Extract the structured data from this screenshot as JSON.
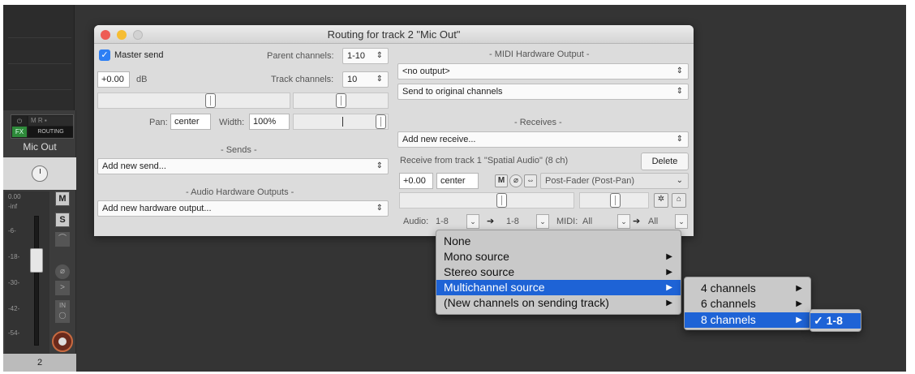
{
  "window": {
    "title": "Routing for track 2 \"Mic Out\""
  },
  "left": {
    "master_send_label": "Master send",
    "master_send_checked": true,
    "parent_channels_label": "Parent channels:",
    "parent_channels_value": "1-10",
    "volume_value": "+0.00",
    "volume_unit": "dB",
    "track_channels_label": "Track channels:",
    "track_channels_value": "10",
    "pan_label": "Pan:",
    "pan_value": "center",
    "width_label": "Width:",
    "width_value": "100%",
    "sends_header": "- Sends -",
    "add_send": "Add new send...",
    "hw_outputs_header": "- Audio Hardware Outputs -",
    "add_hw_output": "Add new hardware output..."
  },
  "right": {
    "midi_hw_header": "- MIDI Hardware Output -",
    "midi_output": "<no output>",
    "midi_channels": "Send to original channels",
    "receives_header": "- Receives -",
    "add_receive": "Add new receive...",
    "receive_from": "Receive from track 1 \"Spatial Audio\" (8 ch)",
    "delete_label": "Delete",
    "recv_volume": "+0.00",
    "recv_pan": "center",
    "mute_label": "M",
    "mode": "Post-Fader (Post-Pan)",
    "audio_label": "Audio:",
    "audio_src": "1-8",
    "audio_dst": "1-8",
    "midi_label": "MIDI:",
    "midi_src": "All",
    "midi_dst": "All"
  },
  "menu1": {
    "items": [
      "None",
      "Mono source",
      "Stereo source",
      "Multichannel source",
      "(New channels on sending track)"
    ],
    "highlighted": "Multichannel source"
  },
  "menu2": {
    "items": [
      "4 channels",
      "6 channels",
      "8 channels"
    ],
    "highlighted": "8 channels"
  },
  "menu3": {
    "items": [
      "1-8"
    ],
    "checkmark": "✓"
  },
  "mixer": {
    "track_name": "Mic Out",
    "fx_label": "FX",
    "routing_label": "ROUTING",
    "mute_btn": "M",
    "solo_btn": "S",
    "track_number": "2",
    "vol_readout": "0.00",
    "peak_readout": "-inf",
    "meter_ticks": [
      "-6-",
      "-18-",
      "-30-",
      "-42-",
      "-54-"
    ],
    "in_label": "IN"
  }
}
